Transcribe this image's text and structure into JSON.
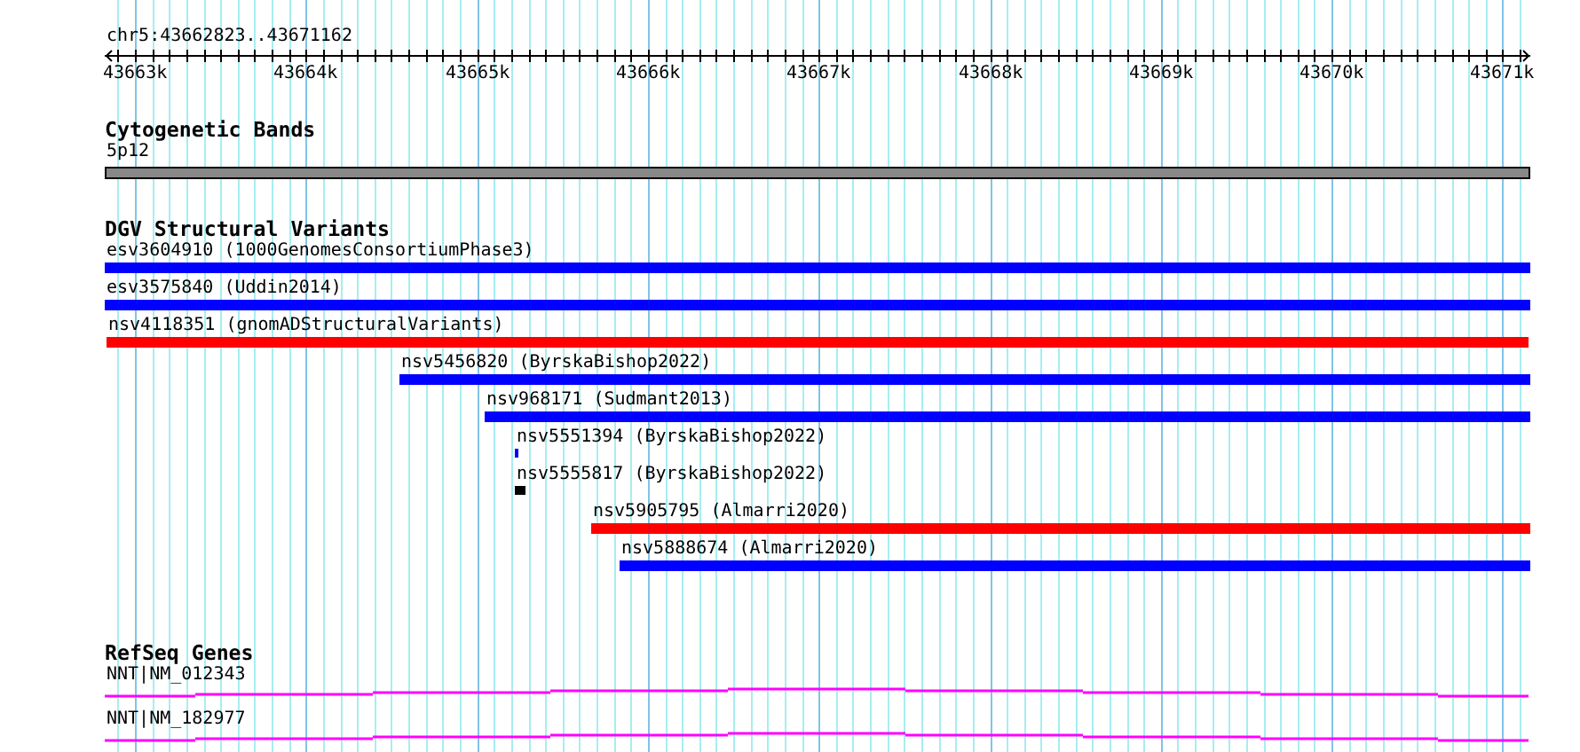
{
  "location": "chr5:43662823..43671162",
  "ruler": {
    "labels": [
      "43663k",
      "43664k",
      "43665k",
      "43666k",
      "43667k",
      "43668k",
      "43669k",
      "43670k",
      "43671k"
    ]
  },
  "tracks": [
    {
      "kind": "bands",
      "title": "Cytogenetic Bands",
      "features": [
        {
          "label": "5p12"
        }
      ]
    },
    {
      "kind": "variants",
      "title": "DGV Structural Variants",
      "features": [
        {
          "label": "esv3604910 (1000GenomesConsortiumPhase3)",
          "color": "#0000ff"
        },
        {
          "label": "esv3575840 (Uddin2014)",
          "color": "#0000ff"
        },
        {
          "label": "nsv4118351 (gnomADStructuralVariants)",
          "color": "#ff0000"
        },
        {
          "label": "nsv5456820 (ByrskaBishop2022)",
          "color": "#0000ff"
        },
        {
          "label": "nsv968171 (Sudmant2013)",
          "color": "#0000ff"
        },
        {
          "label": "nsv5551394 (ByrskaBishop2022)",
          "color": "#0000ff"
        },
        {
          "label": "nsv5555817 (ByrskaBishop2022)",
          "color": "#000000"
        },
        {
          "label": "nsv5905795 (Almarri2020)",
          "color": "#ff0000"
        },
        {
          "label": "nsv5888674 (Almarri2020)",
          "color": "#0000ff"
        }
      ]
    },
    {
      "kind": "genes",
      "title": "RefSeq Genes",
      "features": [
        {
          "label": "NNT|NM_012343"
        },
        {
          "label": "NNT|NM_182977"
        }
      ]
    }
  ]
}
